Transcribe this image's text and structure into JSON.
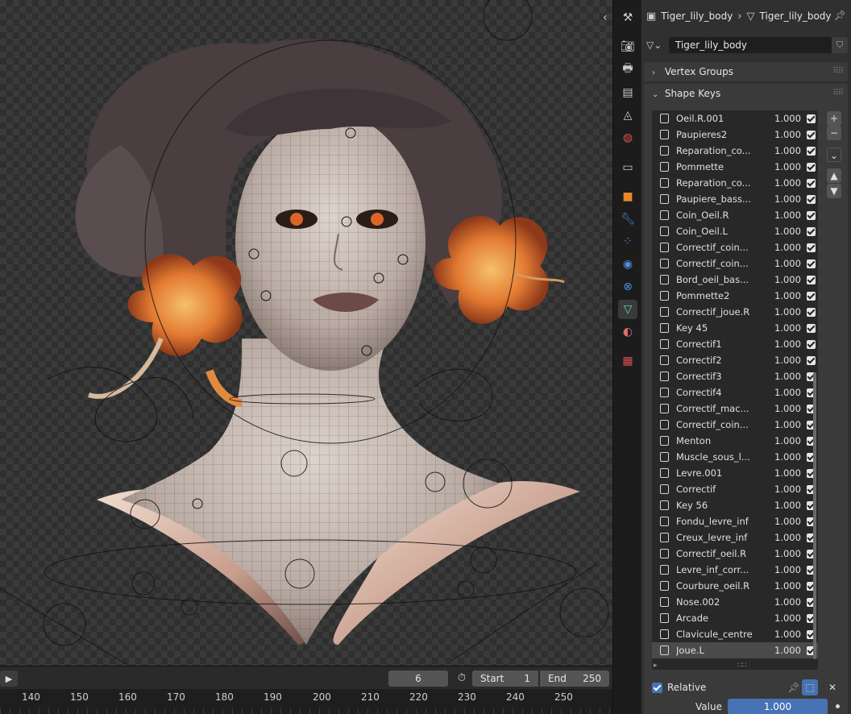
{
  "viewport": {
    "collapse_icon": "chevron-left-icon"
  },
  "timeline": {
    "current_frame": "6",
    "start_label": "Start",
    "start_value": "1",
    "end_label": "End",
    "end_value": "250",
    "ruler": [
      "140",
      "150",
      "160",
      "170",
      "180",
      "190",
      "200",
      "210",
      "220",
      "230",
      "240",
      "250"
    ]
  },
  "properties": {
    "breadcrumb": {
      "object": "Tiger_lily_body",
      "data": "Tiger_lily_body"
    },
    "mesh_name": "Tiger_lily_body",
    "vertex_groups_label": "Vertex Groups",
    "shape_keys_label": "Shape Keys",
    "shape_keys": [
      {
        "name": "Oeil.R.001",
        "value": "1.000"
      },
      {
        "name": "Paupieres2",
        "value": "1.000"
      },
      {
        "name": "Reparation_co...",
        "value": "1.000"
      },
      {
        "name": "Pommette",
        "value": "1.000"
      },
      {
        "name": "Reparation_co...",
        "value": "1.000"
      },
      {
        "name": "Paupiere_bass...",
        "value": "1.000"
      },
      {
        "name": "Coin_Oeil.R",
        "value": "1.000"
      },
      {
        "name": "Coin_Oeil.L",
        "value": "1.000"
      },
      {
        "name": "Correctif_coin...",
        "value": "1.000"
      },
      {
        "name": "Correctif_coin...",
        "value": "1.000"
      },
      {
        "name": "Bord_oeil_bas...",
        "value": "1.000"
      },
      {
        "name": "Pommette2",
        "value": "1.000"
      },
      {
        "name": "Correctif_joue.R",
        "value": "1.000"
      },
      {
        "name": "Key 45",
        "value": "1.000"
      },
      {
        "name": "Correctif1",
        "value": "1.000"
      },
      {
        "name": "Correctif2",
        "value": "1.000"
      },
      {
        "name": "Correctif3",
        "value": "1.000"
      },
      {
        "name": "Correctif4",
        "value": "1.000"
      },
      {
        "name": "Correctif_mac...",
        "value": "1.000"
      },
      {
        "name": "Correctif_coin...",
        "value": "1.000"
      },
      {
        "name": "Menton",
        "value": "1.000"
      },
      {
        "name": "Muscle_sous_l...",
        "value": "1.000"
      },
      {
        "name": "Levre.001",
        "value": "1.000"
      },
      {
        "name": "Correctif",
        "value": "1.000"
      },
      {
        "name": "Key 56",
        "value": "1.000"
      },
      {
        "name": "Fondu_levre_inf",
        "value": "1.000"
      },
      {
        "name": "Creux_levre_inf",
        "value": "1.000"
      },
      {
        "name": "Correctif_oeil.R",
        "value": "1.000"
      },
      {
        "name": "Levre_inf_corr...",
        "value": "1.000"
      },
      {
        "name": "Courbure_oeil.R",
        "value": "1.000"
      },
      {
        "name": "Nose.002",
        "value": "1.000"
      },
      {
        "name": "Arcade",
        "value": "1.000"
      },
      {
        "name": "Clavicule_centre",
        "value": "1.000"
      },
      {
        "name": "Joue.L",
        "value": "1.000"
      }
    ],
    "active_index": 33,
    "relative_label": "Relative",
    "value_label": "Value",
    "value": "1.000"
  },
  "colors": {
    "accent": "#4772b3",
    "active_tab": "#5fd1b3"
  }
}
